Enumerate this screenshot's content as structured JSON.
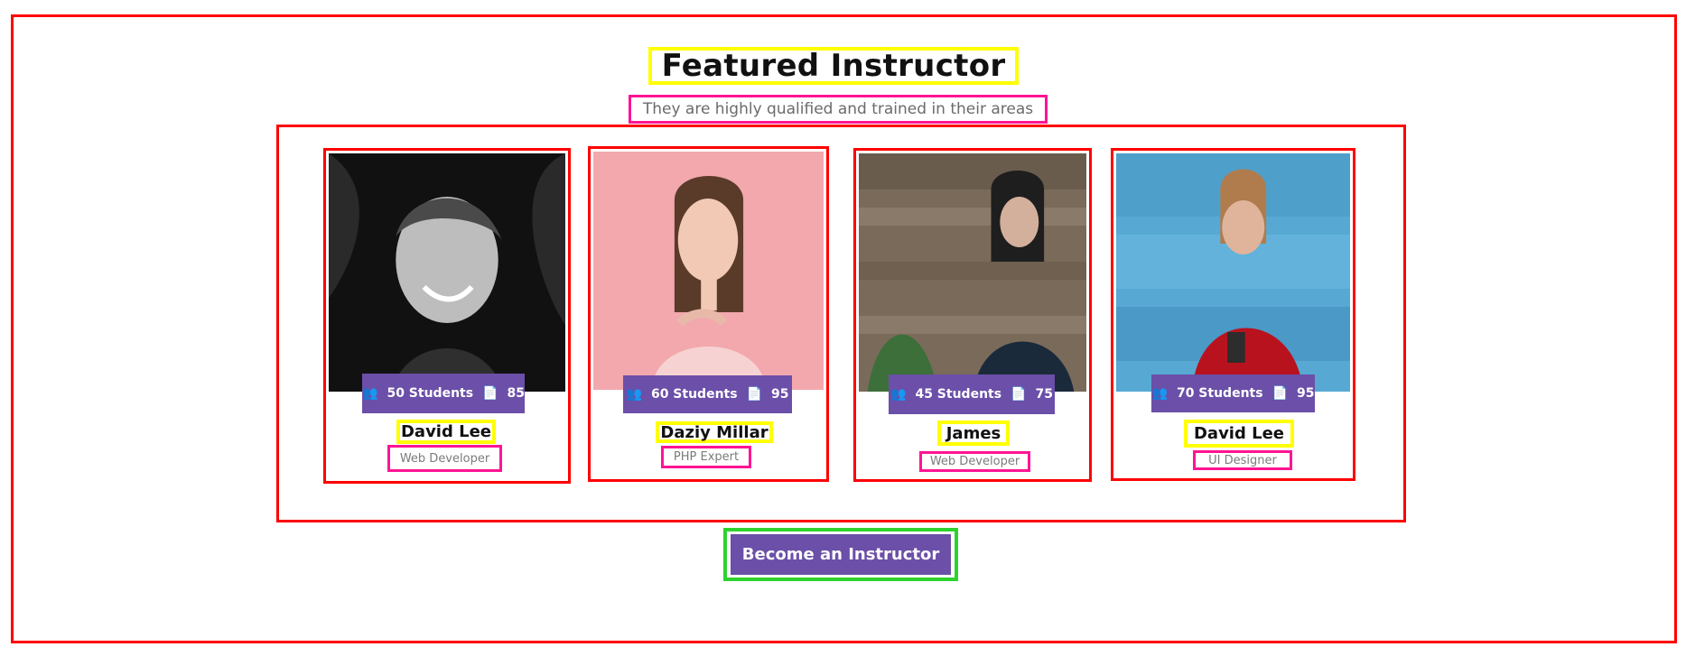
{
  "section": {
    "title": "Featured Instructor",
    "subtitle": "They are highly qualified and trained in their areas"
  },
  "instructors": [
    {
      "name": "David Lee",
      "role": "Web Developer",
      "students_label": "50 Students",
      "lessons": "85",
      "photo_bg": "#1a1a1a",
      "photo_style": "grayscale portrait"
    },
    {
      "name": "Daziy Millar",
      "role": "PHP Expert",
      "students_label": "60 Students",
      "lessons": "95",
      "photo_bg": "#f2a8ad",
      "photo_style": "pink background portrait"
    },
    {
      "name": "James",
      "role": "Web Developer",
      "students_label": "45 Students",
      "lessons": "75",
      "photo_bg": "#7a6a5a",
      "photo_style": "wood fence background"
    },
    {
      "name": "David Lee",
      "role": "UI Designer",
      "students_label": "70 Students",
      "lessons": "95",
      "photo_bg": "#57a9d3",
      "photo_style": "blue wall background"
    }
  ],
  "cta": {
    "label": "Become an Instructor"
  },
  "colors": {
    "accent": "#6b4fa8",
    "frame_red": "#ff0000",
    "frame_yellow": "#ffff00",
    "frame_magenta": "#ff1493",
    "frame_green": "#2fd12f"
  },
  "icons": {
    "students": "users-icon",
    "lessons": "document-icon"
  }
}
